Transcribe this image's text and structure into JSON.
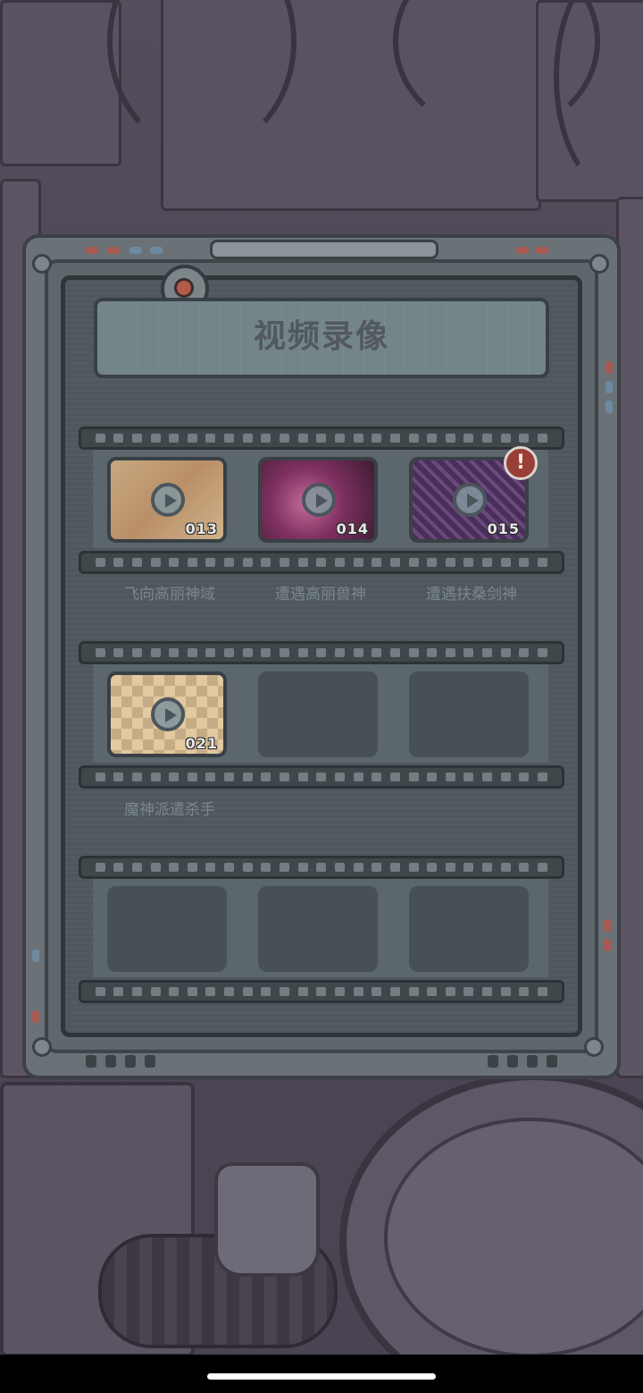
{
  "title": "视频录像",
  "videos": [
    {
      "episode": "013",
      "caption": "飞向高丽神域",
      "thumb_icon": "rocket-scene-thumbnail"
    },
    {
      "episode": "014",
      "caption": "遭遇高丽兽神",
      "thumb_icon": "purple-beast-thumbnail"
    },
    {
      "episode": "015",
      "caption": "遭遇扶桑剑神",
      "thumb_icon": "sword-god-thumbnail",
      "alert": "!"
    },
    {
      "episode": "021",
      "caption": "魔神派遣杀手",
      "thumb_icon": "checker-floor-thumbnail"
    }
  ],
  "colors": {
    "frame": "#6a7277",
    "screen": "#4d575c",
    "alert_badge": "#9a3f37",
    "caption_text": "#7b878c"
  }
}
